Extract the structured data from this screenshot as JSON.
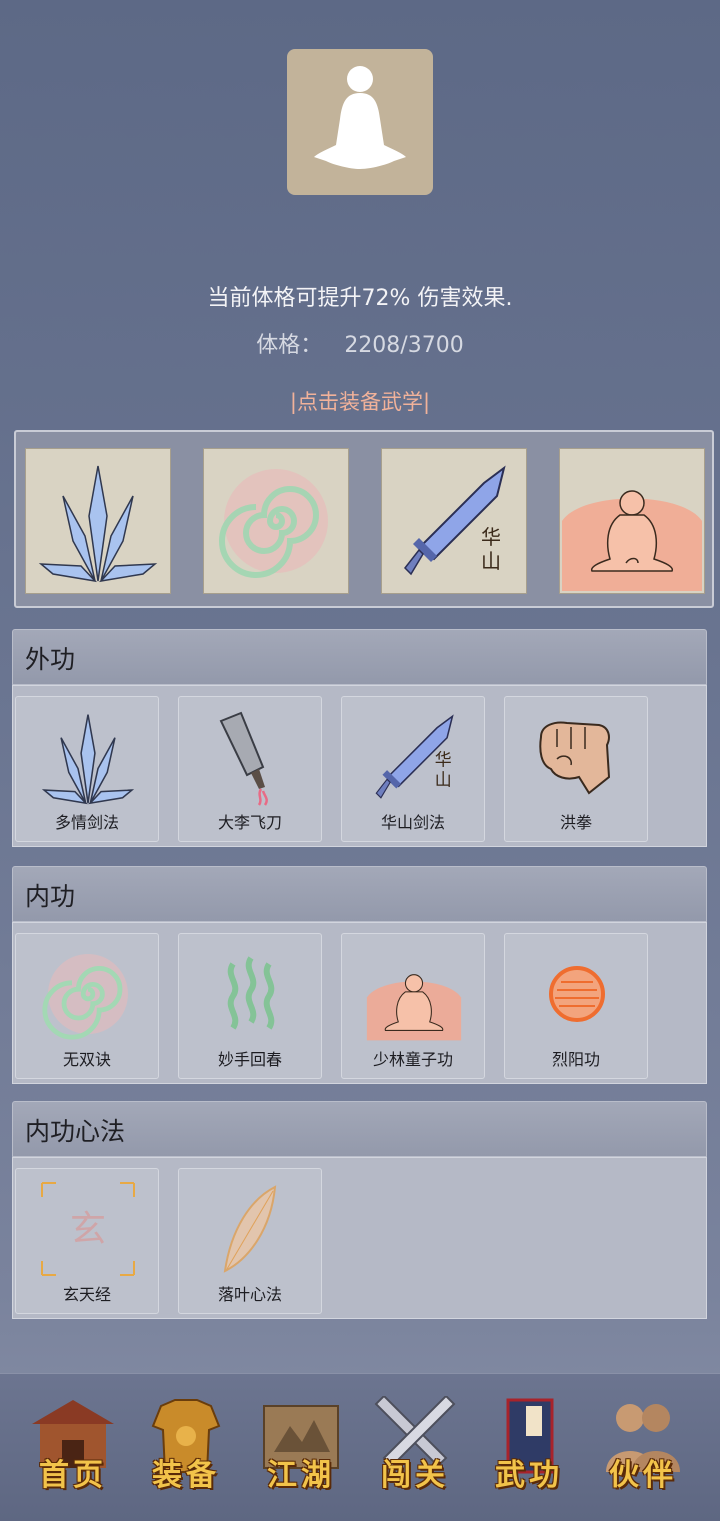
{
  "profile": {
    "bonus_text": "当前体格可提升72% 伤害效果.",
    "constitution_label": "体格：",
    "constitution_value": "2208/3700",
    "equip_hint": "|点击装备武学|"
  },
  "equipped": [
    {
      "icon": "crystal-blades-icon"
    },
    {
      "icon": "spiral-icon"
    },
    {
      "icon": "huashan-sword-icon",
      "glyph": "华山"
    },
    {
      "icon": "meditating-monk-icon"
    }
  ],
  "sections": {
    "outer": {
      "title": "外功",
      "skills": [
        {
          "label": "多情剑法",
          "icon": "crystal-blades-icon"
        },
        {
          "label": "大李飞刀",
          "icon": "cleaver-icon"
        },
        {
          "label": "华山剑法",
          "icon": "huashan-sword-icon",
          "glyph": "华山"
        },
        {
          "label": "洪拳",
          "icon": "fist-icon"
        }
      ]
    },
    "inner": {
      "title": "内功",
      "skills": [
        {
          "label": "无双诀",
          "icon": "spiral-icon"
        },
        {
          "label": "妙手回春",
          "icon": "green-waves-icon"
        },
        {
          "label": "少林童子功",
          "icon": "meditating-monk-icon"
        },
        {
          "label": "烈阳功",
          "icon": "sun-orb-icon"
        }
      ]
    },
    "method": {
      "title": "内功心法",
      "skills": [
        {
          "label": "玄天经",
          "icon": "xuan-scroll-icon",
          "glyph": "玄"
        },
        {
          "label": "落叶心法",
          "icon": "leaf-icon"
        }
      ]
    }
  },
  "nav": [
    {
      "label": "首页",
      "icon": "house-icon"
    },
    {
      "label": "装备",
      "icon": "armor-icon"
    },
    {
      "label": "江湖",
      "icon": "map-scroll-icon"
    },
    {
      "label": "闯关",
      "icon": "crossed-swords-icon"
    },
    {
      "label": "武功",
      "icon": "book-icon"
    },
    {
      "label": "伙伴",
      "icon": "companions-icon"
    }
  ],
  "colors": {
    "background": "#6a7591",
    "hint": "#f1b29a",
    "nav_label": "#f2c34a"
  }
}
